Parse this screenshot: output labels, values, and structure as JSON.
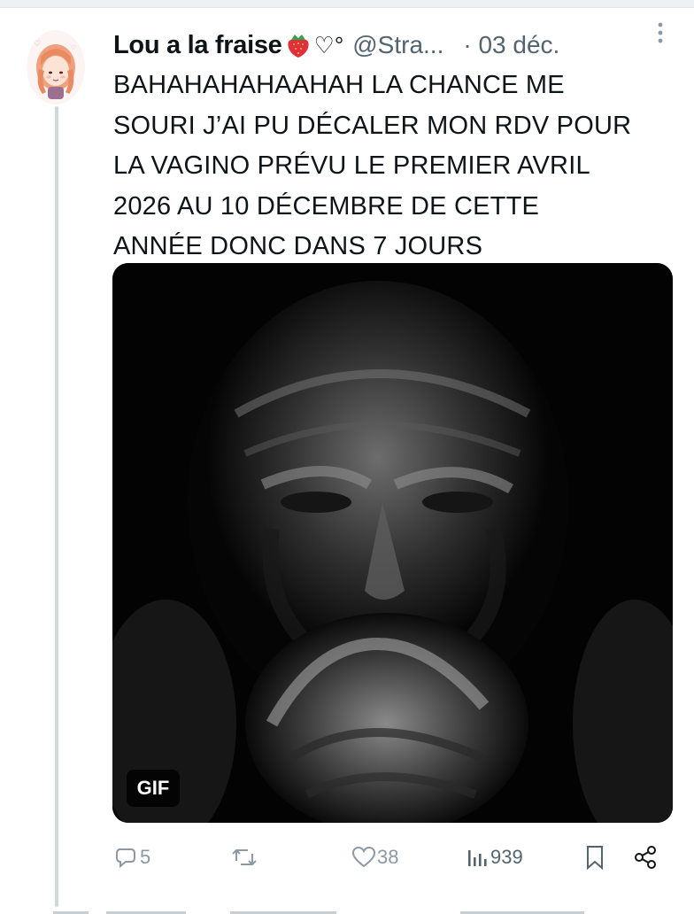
{
  "tweet": {
    "display_name": "Lou a la fraise",
    "name_emoji": "strawberry-emoji",
    "name_heart": "♡°",
    "handle": "@Stra...",
    "date": "· 03 déc.",
    "text_lines": [
      "BAHAHAHAHAAHAH LA CHANCE ME",
      "SOURI J’AI PU DÉCALER MON RDV POUR",
      "LA VAGINO PRÉVU LE PREMIER AVRIL",
      "2026 AU 10 DÉCEMBRE DE CETTE",
      "ANNÉE DONC DANS 7 JOURS"
    ],
    "media": {
      "badge": "GIF"
    },
    "actions": {
      "replies": "5",
      "retweets": "",
      "likes": "38",
      "views": "939"
    }
  },
  "icons": {
    "more": "more-vertical-icon",
    "reply": "reply-bubble-icon",
    "retweet": "retweet-icon",
    "like": "heart-icon",
    "views": "views-bar-icon",
    "bookmark": "bookmark-icon",
    "share": "share-icon"
  },
  "colors": {
    "text": "#0f1419",
    "secondary": "#536471",
    "action_icon": "#8b98a5",
    "thread_line": "#cfd9de"
  }
}
